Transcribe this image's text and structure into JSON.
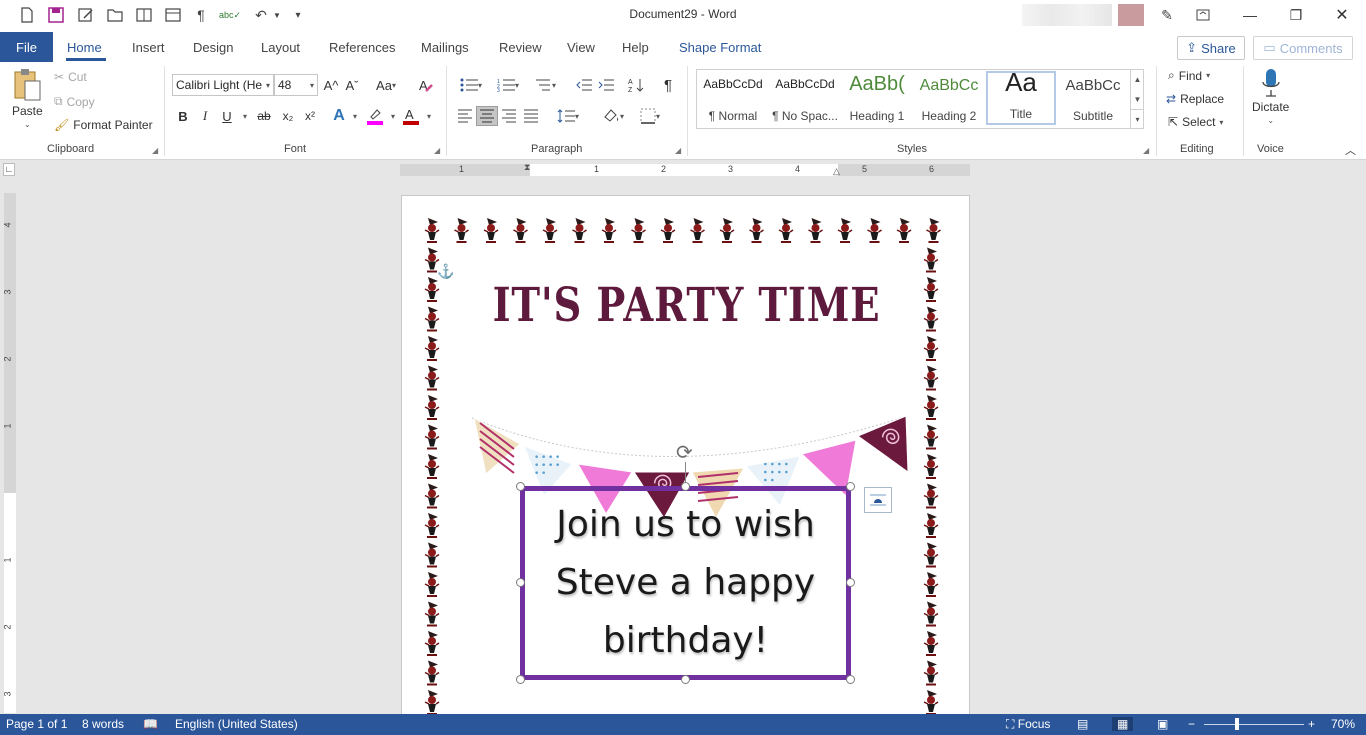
{
  "titlebar": {
    "title": "Document29 - Word",
    "qat_icons": [
      "new-document-icon",
      "save-icon",
      "edit-icon",
      "open-icon",
      "reading-mode-icon",
      "layout-icon",
      "paragraph-mark-icon",
      "spelling-icon",
      "undo-icon",
      "customize-icon"
    ]
  },
  "tabs": {
    "file": "File",
    "home": "Home",
    "insert": "Insert",
    "design": "Design",
    "layout": "Layout",
    "references": "References",
    "mailings": "Mailings",
    "review": "Review",
    "view": "View",
    "help": "Help",
    "shape_format": "Shape Format",
    "share": "Share",
    "comments": "Comments"
  },
  "clipboard": {
    "paste": "Paste",
    "cut": "Cut",
    "copy": "Copy",
    "format_painter": "Format Painter",
    "label": "Clipboard"
  },
  "font": {
    "name": "Calibri Light (He",
    "size": "48",
    "label": "Font",
    "bold": "B",
    "italic": "I",
    "underline": "U",
    "strike": "ab",
    "subscript": "x₂",
    "superscript": "x²",
    "grow": "A^",
    "shrink": "Aˇ",
    "change_case": "Aa",
    "text_effects": "A",
    "highlight_color": "#ff00ff",
    "font_color": "#c00000"
  },
  "paragraph": {
    "label": "Paragraph",
    "pilcrow": "¶"
  },
  "styles": {
    "label": "Styles",
    "items": [
      {
        "preview": "AaBbCcDd",
        "name": "¶ Normal"
      },
      {
        "preview": "AaBbCcDd",
        "name": "¶ No Spac..."
      },
      {
        "preview": "AaBb(",
        "name": "Heading 1"
      },
      {
        "preview": "AaBbCc",
        "name": "Heading 2"
      },
      {
        "preview": "Aa",
        "name": "Title"
      },
      {
        "preview": "AaBbCc",
        "name": "Subtitle"
      }
    ]
  },
  "editing": {
    "find": "Find",
    "replace": "Replace",
    "select": "Select",
    "label": "Editing"
  },
  "voice": {
    "dictate": "Dictate",
    "label": "Voice"
  },
  "ruler": {
    "h_numbers": [
      "1",
      "1",
      "2",
      "3",
      "4",
      "5",
      "6"
    ],
    "v_numbers": [
      "4",
      "3",
      "2",
      "1",
      "1",
      "2",
      "3"
    ]
  },
  "document": {
    "title": "IT'S PARTY TIME",
    "textbox_lines": [
      "Join us to wish",
      "Steve a happy",
      "birthday!"
    ],
    "title_color": "#5e1a3c",
    "textbox_border_color": "#7030a0",
    "bunting_colors": [
      "#f0e0c0",
      "#e8f2f8",
      "#f07ad8",
      "#6b1a3e",
      "#f0d8b0",
      "#e8f2f8",
      "#f07ad8",
      "#6b1a3e"
    ]
  },
  "statusbar": {
    "page": "Page 1 of 1",
    "words": "8 words",
    "language": "English (United States)",
    "focus": "Focus",
    "zoom": "70%"
  }
}
